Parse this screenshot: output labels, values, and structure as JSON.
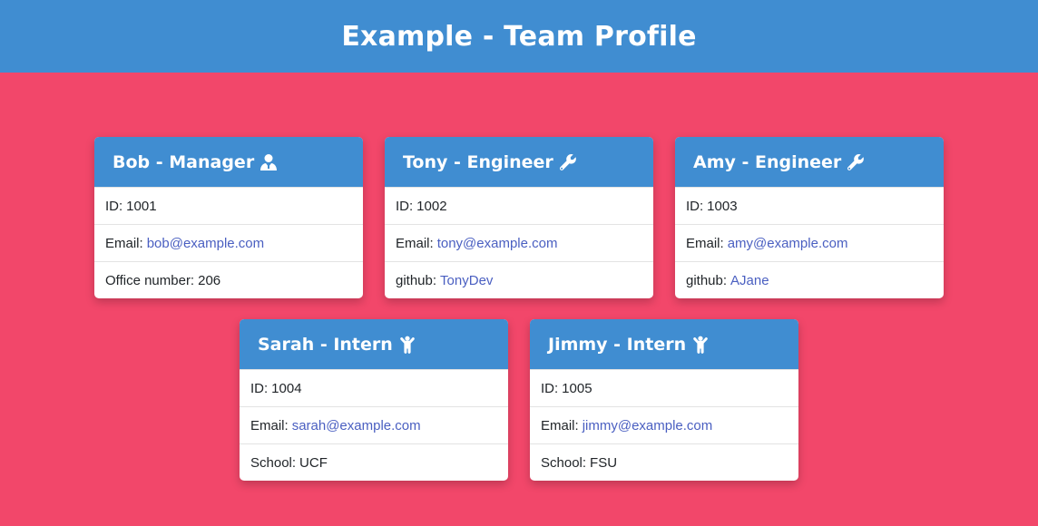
{
  "header": {
    "title": "Example - Team Profile"
  },
  "colors": {
    "background": "#f2476a",
    "accent": "#408dd1",
    "link": "#4a5fc1"
  },
  "cards": [
    {
      "title": "Bob - Manager",
      "icon": "manager-user-icon",
      "id_label": "ID:",
      "id": "1001",
      "email_label": "Email:",
      "email": "bob@example.com",
      "extra_label": "Office number:",
      "extra": "206"
    },
    {
      "title": "Tony - Engineer",
      "icon": "wrench-icon",
      "id_label": "ID:",
      "id": "1002",
      "email_label": "Email:",
      "email": "tony@example.com",
      "extra_label": "github:",
      "extra": "TonyDev"
    },
    {
      "title": "Amy - Engineer",
      "icon": "wrench-icon",
      "id_label": "ID:",
      "id": "1003",
      "email_label": "Email:",
      "email": "amy@example.com",
      "extra_label": "github:",
      "extra": "AJane"
    },
    {
      "title": "Sarah - Intern",
      "icon": "child-icon",
      "id_label": "ID:",
      "id": "1004",
      "email_label": "Email:",
      "email": "sarah@example.com",
      "extra_label": "School:",
      "extra": "UCF"
    },
    {
      "title": "Jimmy - Intern",
      "icon": "child-icon",
      "id_label": "ID:",
      "id": "1005",
      "email_label": "Email:",
      "email": "jimmy@example.com",
      "extra_label": "School:",
      "extra": "FSU"
    }
  ]
}
